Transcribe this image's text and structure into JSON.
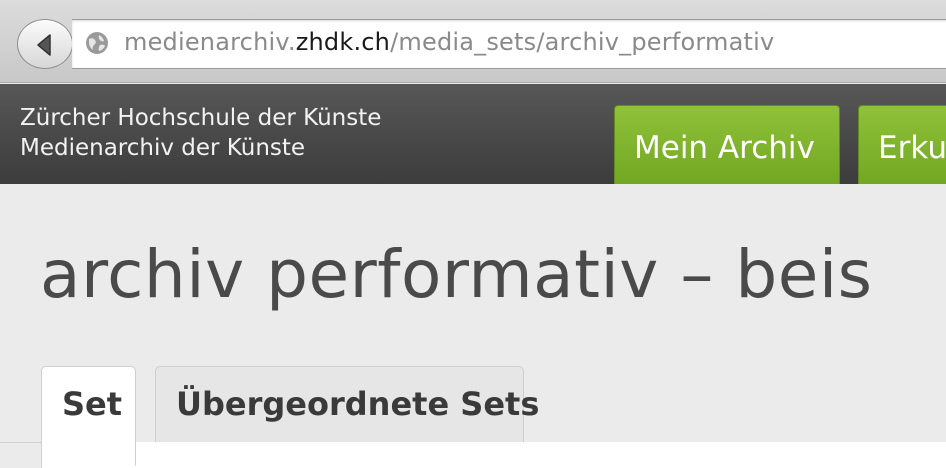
{
  "browser": {
    "url_prefix": "medienarchiv.",
    "url_host": "zhdk.ch",
    "url_path": "/media_sets/archiv_performativ",
    "icons": {
      "back": "back-arrow-icon",
      "site": "globe-icon"
    }
  },
  "header": {
    "line1": "Zürcher Hochschule der Künste",
    "line2": "Medienarchiv der Künste",
    "nav": [
      {
        "label": "Mein Archiv"
      },
      {
        "label": "Erku"
      }
    ],
    "accent": "#80b52c"
  },
  "main": {
    "title": "archiv performativ – beis",
    "tabs": [
      {
        "label": "Set",
        "active": true
      },
      {
        "label": "Übergeordnete Sets",
        "active": false
      }
    ]
  }
}
